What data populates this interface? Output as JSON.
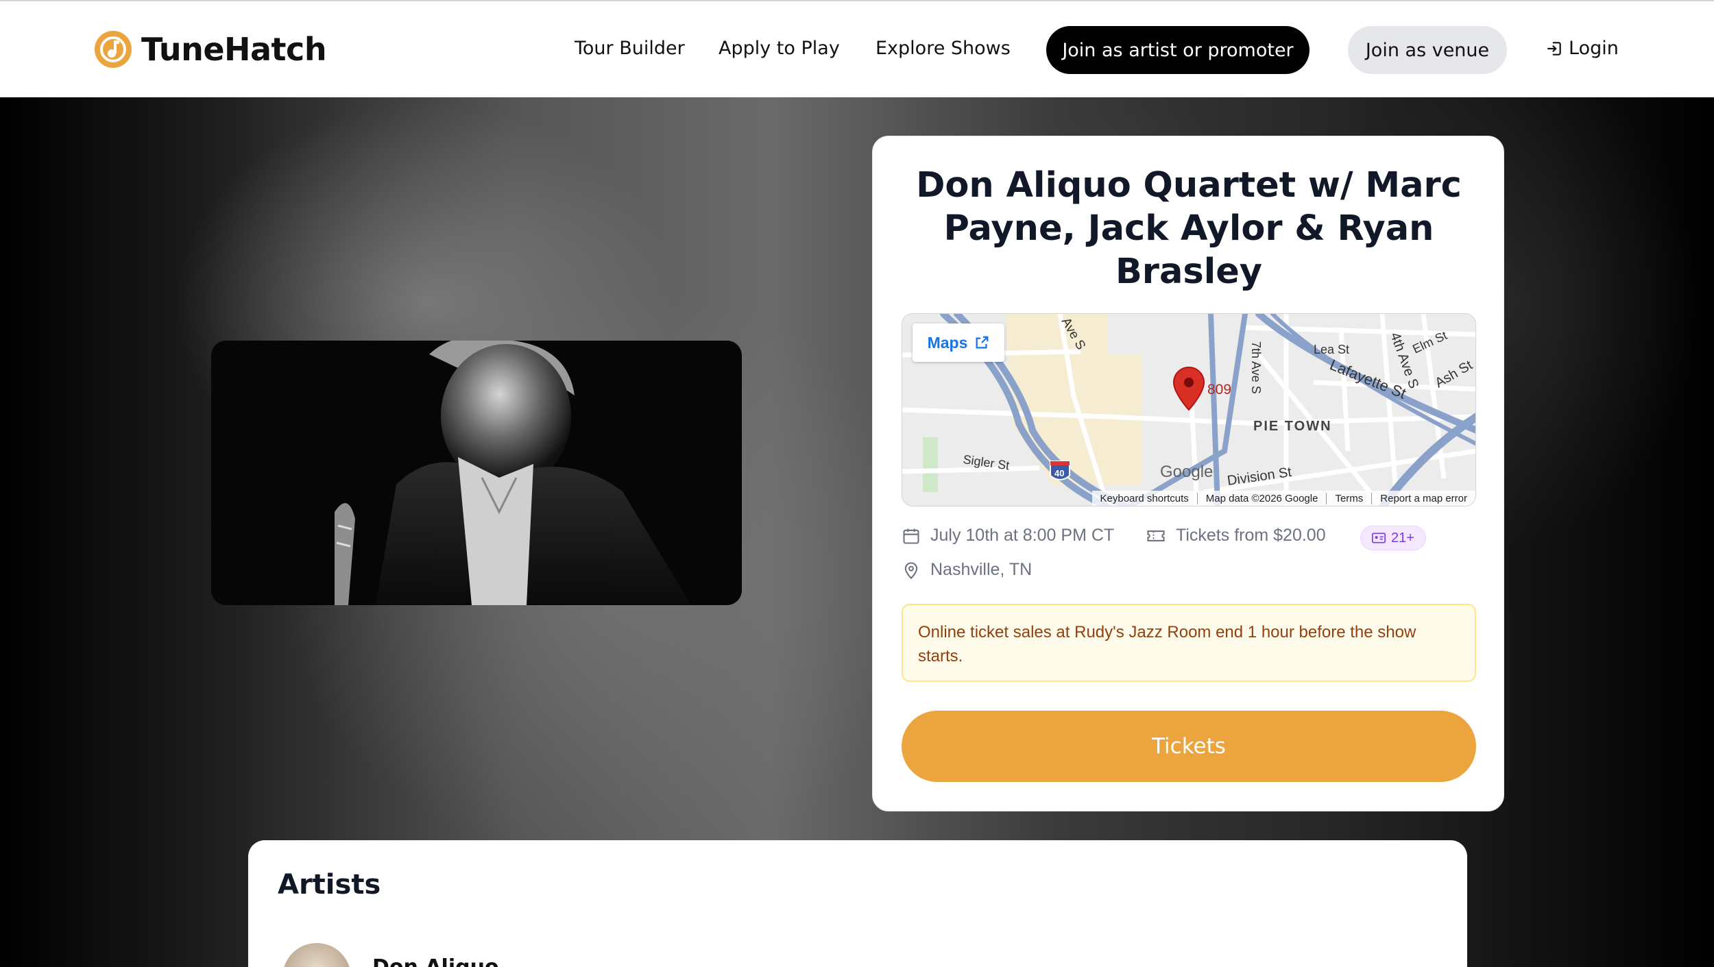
{
  "header": {
    "brand_name": "TuneHatch",
    "nav": {
      "tour_builder": "Tour Builder",
      "apply_to_play": "Apply to Play",
      "explore_shows": "Explore Shows",
      "join_artist": "Join as artist or promoter",
      "join_venue": "Join as venue",
      "login": "Login"
    }
  },
  "event": {
    "title": "Don Aliquo Quartet w/ Marc Payne, Jack Aylor & Ryan Brasley",
    "date": "July 10th at 8:00 PM CT",
    "tickets_from": "Tickets from $20.00",
    "age_badge": "21+",
    "location": "Nashville, TN",
    "notice": "Online ticket sales at Rudy's Jazz Room end 1 hour before the show starts.",
    "tickets_button": "Tickets"
  },
  "map": {
    "maps_label": "Maps",
    "pin_label": "809",
    "neighborhood": "PIE TOWN",
    "streets": [
      "Lea St",
      "Elm St",
      "Lafayette St",
      "Ash St",
      "4th Ave S",
      "7th Ave S",
      "Sigler St",
      "Division St",
      "Ave S"
    ],
    "highway": "40",
    "google_logo": "Google",
    "footer": [
      "Keyboard shortcuts",
      "Map data ©2026 Google",
      "Terms",
      "Report a map error"
    ]
  },
  "artists": {
    "heading": "Artists",
    "items": [
      {
        "name": "Don Aliquo"
      }
    ]
  },
  "colors": {
    "accent": "#eba43e",
    "notice_bg": "#fffbeb",
    "notice_text": "#92400e",
    "badge": "#7c3aed"
  }
}
